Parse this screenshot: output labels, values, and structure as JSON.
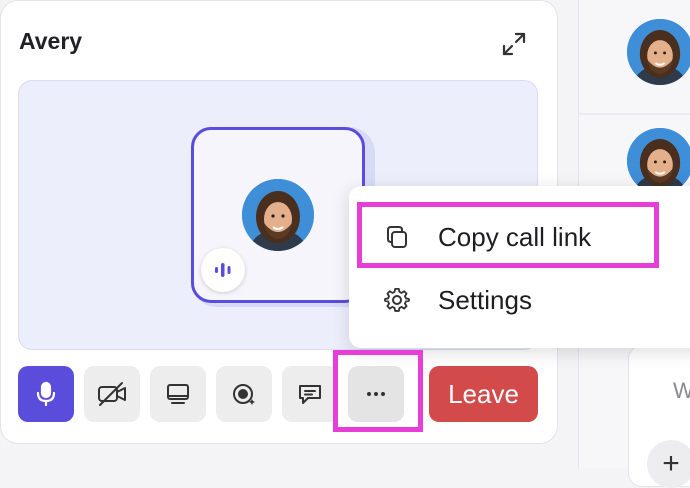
{
  "call": {
    "participant_name": "Avery"
  },
  "controls": {
    "mic": "mic-icon",
    "camera": "camera-off-icon",
    "screen": "screen-share-icon",
    "record": "record-icon",
    "chat": "chat-icon",
    "more": "more-icon",
    "leave_label": "Leave"
  },
  "menu": {
    "items": [
      {
        "label": "Copy call link",
        "icon": "copy-icon"
      },
      {
        "label": "Settings",
        "icon": "gear-icon"
      }
    ]
  },
  "right_panel": {
    "partial_text": "W",
    "add_symbol": "+"
  },
  "colors": {
    "accent": "#5b4ddb",
    "leave": "#d24a4a",
    "highlight": "#e83ed8"
  }
}
